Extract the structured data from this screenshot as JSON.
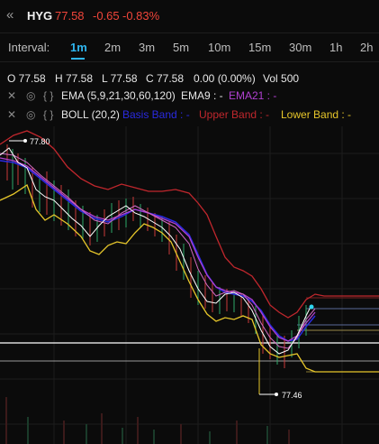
{
  "header": {
    "back_icon": "double-chevron-left-icon",
    "symbol": "HYG",
    "last_price": "77.58",
    "change": "-0.65",
    "change_pct": "-0.83%",
    "down_color": "#f0453a"
  },
  "intervals": {
    "label": "Interval:",
    "items": [
      "1m",
      "2m",
      "3m",
      "5m",
      "10m",
      "15m",
      "30m",
      "1h",
      "2h"
    ],
    "selected": "1m",
    "accent": "#2fb6f0"
  },
  "ohlc": {
    "open": "O 77.58",
    "high": "H 77.58",
    "low": "L 77.58",
    "close": "C 77.58",
    "change": "0.00 (0.00%)",
    "volume": "Vol 500"
  },
  "indicators": {
    "ema": {
      "name": "EMA (5,9,21,30,60,120)",
      "ema9": "EMA9 : -",
      "ema21": "EMA21 : -",
      "ema21_color": "#b040d0"
    },
    "boll": {
      "name": "BOLL (20,2)",
      "basis": "Basis Band : -",
      "upper": "Upper Band : -",
      "lower": "Lower Band : -",
      "basis_color": "#2a2ae0",
      "upper_color": "#c0272d",
      "lower_color": "#e6c62a"
    }
  },
  "chart": {
    "high_marker": "77.80",
    "low_marker": "77.46"
  }
}
